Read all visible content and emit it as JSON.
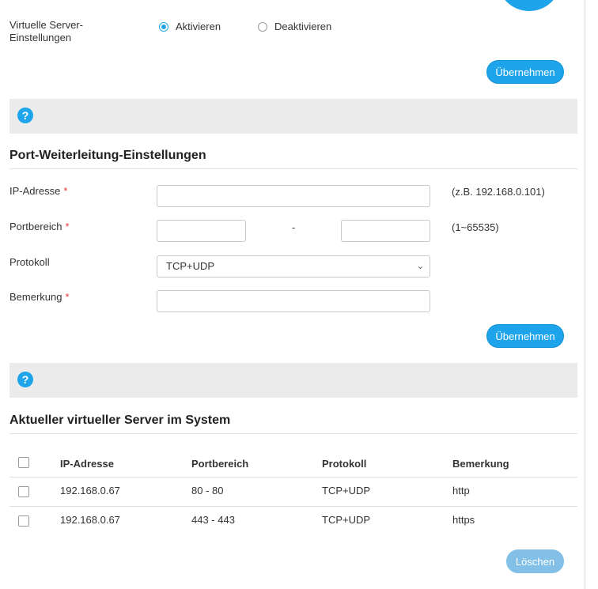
{
  "virtual_server": {
    "label": "Virtuelle Server-Einstellungen",
    "options": [
      {
        "label": "Aktivieren",
        "checked": true
      },
      {
        "label": "Deaktivieren",
        "checked": false
      }
    ],
    "apply_label": "Übernehmen"
  },
  "help": {
    "icon_text": "?"
  },
  "port_forwarding": {
    "title": "Port-Weiterleitung-Einstellungen",
    "ip_label": "IP-Adresse",
    "ip_value": "",
    "ip_hint": "(z.B. 192.168.0.101)",
    "port_label": "Portbereich",
    "port_separator": "-",
    "port_from": "",
    "port_to": "",
    "port_hint": "(1~65535)",
    "protocol_label": "Protokoll",
    "protocol_value": "TCP+UDP",
    "remark_label": "Bemerkung",
    "remark_value": "",
    "required_mark": "*",
    "apply_label": "Übernehmen"
  },
  "current_servers": {
    "title": "Aktueller virtueller Server im System",
    "columns": [
      "IP-Adresse",
      "Portbereich",
      "Protokoll",
      "Bemerkung"
    ],
    "rows": [
      {
        "ip": "192.168.0.67",
        "ports": "80 - 80",
        "protocol": "TCP+UDP",
        "remark": "http"
      },
      {
        "ip": "192.168.0.67",
        "ports": "443 - 443",
        "protocol": "TCP+UDP",
        "remark": "https"
      }
    ],
    "delete_label": "Löschen"
  },
  "colors": {
    "accent": "#1ea4ea",
    "required": "#e03a3a",
    "panel": "#ebebeb"
  }
}
